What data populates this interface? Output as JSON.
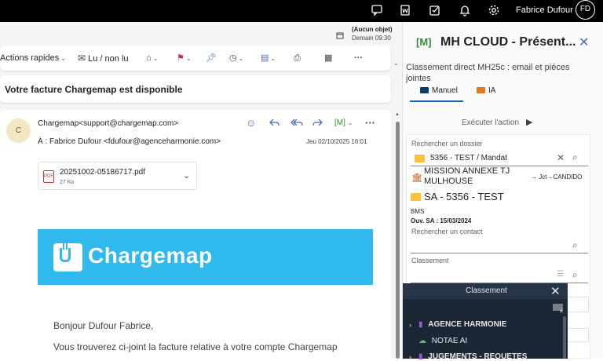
{
  "topbar": {
    "icons": [
      "chat-icon",
      "word-icon",
      "task-icon",
      "bell-icon",
      "gear-icon"
    ],
    "user_name": "Fabrice Dufour",
    "avatar_initials": "FD"
  },
  "info": {
    "object_line1": "(Aucun objet)",
    "object_line2": "Demain 09:30"
  },
  "toolbar": {
    "quick_actions": "Actions rapides",
    "read_unread": "Lu / non lu"
  },
  "message": {
    "subject": "Votre facture Chargemap est disponible",
    "sender_initial": "C",
    "from": "Chargemap<support@chargemap.com>",
    "to": "À :  Fabrice Dufour <fdufour@agenceharmonie.com>",
    "date": "Jeu 02/10/2025 16:01",
    "attachment_name": "20251002-05186717.pdf",
    "attachment_size": "27 Ko",
    "banner_text": "Chargemap",
    "greeting": "Bonjour Dufour Fabrice,",
    "body": "Vous trouverez ci-joint la facture relative à votre compte Chargemap"
  },
  "addin": {
    "logo": "[M]",
    "title": "MH CLOUD - Présent...",
    "description": "Classement direct MH25c : email et pièces jointes",
    "tab_manuel": "Manuel",
    "tab_ia": "IA",
    "run_action": "Exécuter l'action",
    "folder_search_label": "Rechercher un dossier",
    "folder_search_value": "5356 - TEST / Mandat",
    "mission": "MISSION ANNEXE TJ MULHOUSE",
    "jct": "→ Jct→CANDIDO",
    "sa_title": "SA - 5356 - TEST",
    "bms": "BMS",
    "ouv": "Ouv. SA : 15/03/2024",
    "contact_label": "Rechercher un contact",
    "class_label": "Classement"
  },
  "popup": {
    "title": "Classement",
    "rows": [
      {
        "label": "AGENCE HARMONIE"
      },
      {
        "label": "NOTAE AI"
      },
      {
        "label": "JUGEMENTS - REQUETES"
      }
    ]
  },
  "colors": {
    "accent": "#0f6cbd",
    "chargemap_blue": "#2fb9ec",
    "popup_bg": "#1b2735",
    "mh_green": "#2f8f3b"
  }
}
